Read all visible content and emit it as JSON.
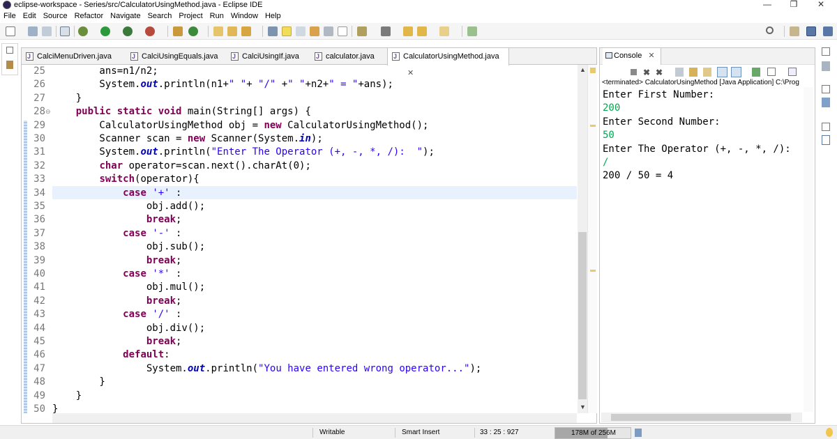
{
  "window": {
    "title": "eclipse-workspace - Series/src/CalculatorUsingMethod.java - Eclipse IDE",
    "minimize": "—",
    "restore": "❐",
    "close": "✕"
  },
  "menu": [
    "File",
    "Edit",
    "Source",
    "Refactor",
    "Navigate",
    "Search",
    "Project",
    "Run",
    "Window",
    "Help"
  ],
  "toolbar_icons": [
    "new-icon",
    "save-icon",
    "save-all-icon",
    "skip-breakpoints-icon",
    "debug-icon",
    "run-icon",
    "coverage-icon",
    "external-tools-icon",
    "new-java-project-icon",
    "new-class-icon",
    "open-type-icon",
    "open-task-icon",
    "search-icon",
    "toggle-mark-occurrences-icon",
    "toggle-block-selection-icon",
    "show-whitespace-icon",
    "next-annotation-icon",
    "previous-annotation-icon",
    "last-edit-location-icon",
    "back-icon",
    "forward-icon",
    "pin-editor-icon",
    "quick-access-search-icon",
    "open-perspective-icon",
    "java-perspective-icon"
  ],
  "editor": {
    "tabs": [
      {
        "label": "CalciMenuDriven.java",
        "active": false
      },
      {
        "label": "CalciUsingEquals.java",
        "active": false
      },
      {
        "label": "CalciUsingIf.java",
        "active": false
      },
      {
        "label": "calculator.java",
        "active": false
      },
      {
        "label": "CalculatorUsingMethod.java",
        "active": true
      }
    ],
    "tab_close": "✕",
    "lines": [
      {
        "n": "25",
        "t": [
          [
            "",
            "        ans=n1/n2;"
          ]
        ]
      },
      {
        "n": "26",
        "t": [
          [
            "",
            "        System."
          ],
          [
            "fld",
            "out"
          ],
          [
            "",
            ".println(n1+"
          ],
          [
            "str",
            "\" \""
          ],
          [
            "",
            "+ "
          ],
          [
            "str",
            "\"/\""
          ],
          [
            "",
            " +"
          ],
          [
            "str",
            "\" \""
          ],
          [
            "",
            "+n2+"
          ],
          [
            "str",
            "\" = \""
          ],
          [
            "",
            "+ans);"
          ]
        ]
      },
      {
        "n": "27",
        "t": [
          [
            "",
            "    }"
          ]
        ]
      },
      {
        "n": "28",
        "t": [
          [
            "",
            "    "
          ],
          [
            "kw",
            "public static void"
          ],
          [
            "",
            " main(String[] args) {"
          ]
        ],
        "fold": "⊖"
      },
      {
        "n": "29",
        "t": [
          [
            "",
            "        CalculatorUsingMethod obj = "
          ],
          [
            "kw",
            "new"
          ],
          [
            "",
            " CalculatorUsingMethod();"
          ]
        ]
      },
      {
        "n": "30",
        "t": [
          [
            "",
            "        Scanner scan = "
          ],
          [
            "kw",
            "new"
          ],
          [
            "",
            " Scanner(System."
          ],
          [
            "fld",
            "in"
          ],
          [
            "",
            ");"
          ]
        ]
      },
      {
        "n": "31",
        "t": [
          [
            "",
            "        System."
          ],
          [
            "fld",
            "out"
          ],
          [
            "",
            ".println("
          ],
          [
            "str",
            "\"Enter The Operator (+, -, *, /):  \""
          ],
          [
            "",
            ");"
          ]
        ]
      },
      {
        "n": "32",
        "t": [
          [
            "",
            "        "
          ],
          [
            "kw",
            "char"
          ],
          [
            "",
            " operator=scan.next().charAt(0);"
          ]
        ]
      },
      {
        "n": "33",
        "t": [
          [
            "",
            "        "
          ],
          [
            "kw",
            "switch"
          ],
          [
            "",
            "(operator){"
          ]
        ]
      },
      {
        "n": "34",
        "t": [
          [
            "",
            "            "
          ],
          [
            "kw",
            "case"
          ],
          [
            "",
            " "
          ],
          [
            "str",
            "'+'"
          ],
          [
            "",
            " :"
          ]
        ]
      },
      {
        "n": "35",
        "t": [
          [
            "",
            "                obj.add();"
          ]
        ]
      },
      {
        "n": "36",
        "t": [
          [
            "",
            "                "
          ],
          [
            "kw",
            "break"
          ],
          [
            "",
            ";"
          ]
        ]
      },
      {
        "n": "37",
        "t": [
          [
            "",
            "            "
          ],
          [
            "kw",
            "case"
          ],
          [
            "",
            " "
          ],
          [
            "str",
            "'-'"
          ],
          [
            "",
            " :"
          ]
        ]
      },
      {
        "n": "38",
        "t": [
          [
            "",
            "                obj.sub();"
          ]
        ]
      },
      {
        "n": "39",
        "t": [
          [
            "",
            "                "
          ],
          [
            "kw",
            "break"
          ],
          [
            "",
            ";"
          ]
        ]
      },
      {
        "n": "40",
        "t": [
          [
            "",
            "            "
          ],
          [
            "kw",
            "case"
          ],
          [
            "",
            " "
          ],
          [
            "str",
            "'*'"
          ],
          [
            "",
            " :"
          ]
        ]
      },
      {
        "n": "41",
        "t": [
          [
            "",
            "                obj.mul();"
          ]
        ]
      },
      {
        "n": "42",
        "t": [
          [
            "",
            "                "
          ],
          [
            "kw",
            "break"
          ],
          [
            "",
            ";"
          ]
        ]
      },
      {
        "n": "43",
        "t": [
          [
            "",
            "            "
          ],
          [
            "kw",
            "case"
          ],
          [
            "",
            " "
          ],
          [
            "str",
            "'/'"
          ],
          [
            "",
            " :"
          ]
        ]
      },
      {
        "n": "44",
        "t": [
          [
            "",
            "                obj.div();"
          ]
        ]
      },
      {
        "n": "45",
        "t": [
          [
            "",
            "                "
          ],
          [
            "kw",
            "break"
          ],
          [
            "",
            ";"
          ]
        ]
      },
      {
        "n": "46",
        "t": [
          [
            "",
            "            "
          ],
          [
            "kw",
            "default"
          ],
          [
            "",
            ":"
          ]
        ]
      },
      {
        "n": "47",
        "t": [
          [
            "",
            "                System."
          ],
          [
            "fld",
            "out"
          ],
          [
            "",
            ".println("
          ],
          [
            "str",
            "\"You have entered wrong operator...\""
          ],
          [
            "",
            ");"
          ]
        ]
      },
      {
        "n": "48",
        "t": [
          [
            "",
            "        }"
          ]
        ]
      },
      {
        "n": "49",
        "t": [
          [
            "",
            "    }"
          ]
        ]
      },
      {
        "n": "50",
        "t": [
          [
            "",
            "}"
          ]
        ]
      }
    ]
  },
  "console": {
    "tab_label": "Console",
    "tab_close": "✕",
    "status": "<terminated> CalculatorUsingMethod [Java Application] C:\\Prog",
    "output": [
      {
        "text": "Enter First Number:",
        "input": false
      },
      {
        "text": "200",
        "input": true
      },
      {
        "text": "Enter Second Number:",
        "input": false
      },
      {
        "text": "50",
        "input": true
      },
      {
        "text": "Enter The Operator (+, -, *, /):",
        "input": false
      },
      {
        "text": "/",
        "input": true
      },
      {
        "text": "200 / 50 = 4",
        "input": false
      }
    ]
  },
  "statusbar": {
    "writable": "Writable",
    "insert_mode": "Smart Insert",
    "position": "33 : 25 : 927",
    "heap": "178M of 256M",
    "heap_used_fraction": 0.695
  },
  "colors": {
    "keyword": "#7f0055",
    "string": "#2a00ff",
    "static_field": "#0000c0",
    "console_input": "#00a84f",
    "current_line": "#e8f2fe"
  }
}
